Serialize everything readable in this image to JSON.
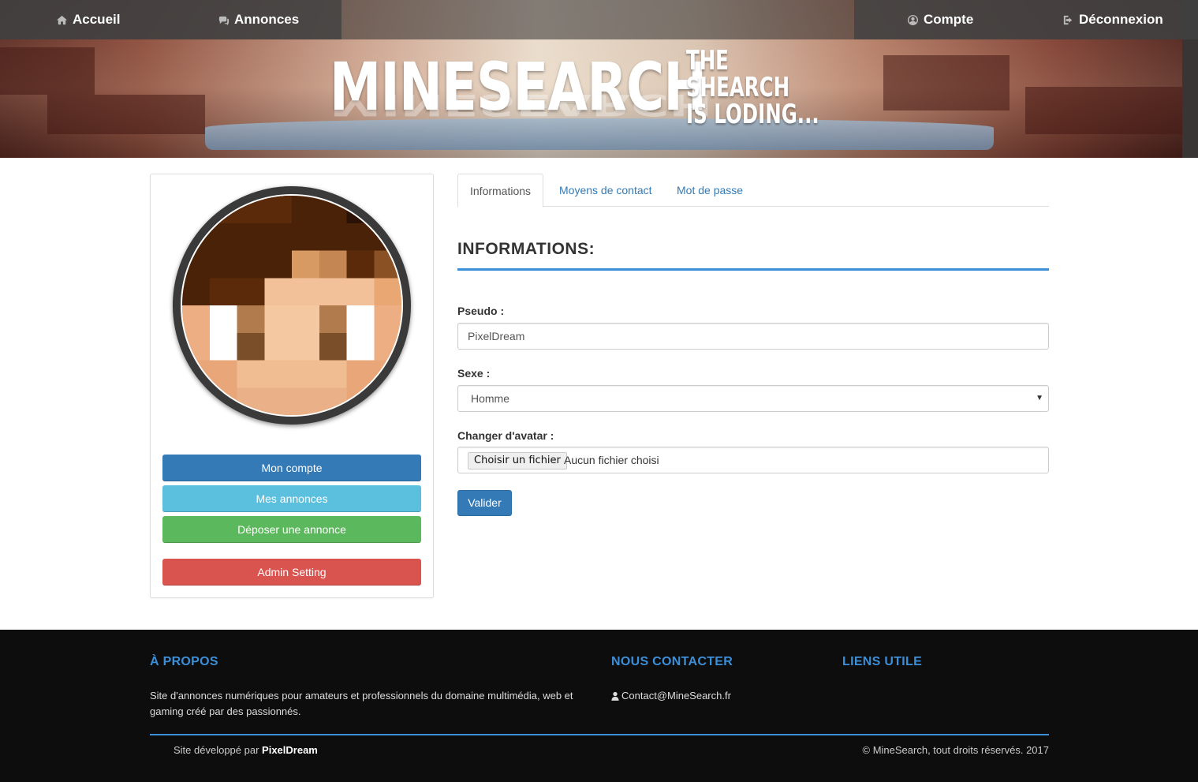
{
  "nav": {
    "home_label": "Accueil",
    "ads_label": "Annonces",
    "account_label": "Compte",
    "logout_label": "Déconnexion"
  },
  "banner": {
    "logo_main": "MINESEARCH",
    "logo_tag_line1": "THE",
    "logo_tag_line2": "SHEARCH",
    "logo_tag_line3": "IS LODING..."
  },
  "sidebar": {
    "buttons": [
      {
        "label": "Mon compte",
        "color": "#337ab7"
      },
      {
        "label": "Mes annonces",
        "color": "#5bc0de"
      },
      {
        "label": "Déposer une annonce",
        "color": "#5cb85c"
      },
      {
        "label": "Admin Setting",
        "color": "#d9534f"
      }
    ]
  },
  "tabs": [
    {
      "label": "Informations",
      "active": true
    },
    {
      "label": "Moyens de contact",
      "active": false
    },
    {
      "label": "Mot de passe",
      "active": false
    }
  ],
  "form": {
    "title": "INFORMATIONS:",
    "pseudo_label": "Pseudo :",
    "pseudo_value": "PixelDream",
    "sexe_label": "Sexe :",
    "sexe_value": "Homme",
    "avatar_label": "Changer d'avatar :",
    "file_button": "Choisir un fichier",
    "file_status": "Aucun fichier choisi",
    "submit_label": "Valider"
  },
  "footer": {
    "about_heading": "À PROPOS",
    "about_text": "Site d'annonces numériques pour amateurs et professionnels du domaine multimédia, web et gaming créé par des passionnés.",
    "contact_heading": "NOUS CONTACTER",
    "contact_email": "Contact@MineSearch.fr",
    "links_heading": "LIENS UTILE",
    "credit_prefix": "Site développé par",
    "credit_name": "PixelDream",
    "copyright": "© MineSearch, tout droits réservés. 2017"
  },
  "colors": {
    "accent": "#3b8ed8",
    "primary": "#337ab7",
    "footer_bg": "#0e0d0e",
    "nav_bg": "#404040"
  },
  "icons": {
    "home": "home-icon",
    "ads": "comments-icon",
    "account": "user-circle-icon",
    "logout": "sign-out-icon",
    "contact": "user-icon",
    "select": "caret-down-icon"
  }
}
